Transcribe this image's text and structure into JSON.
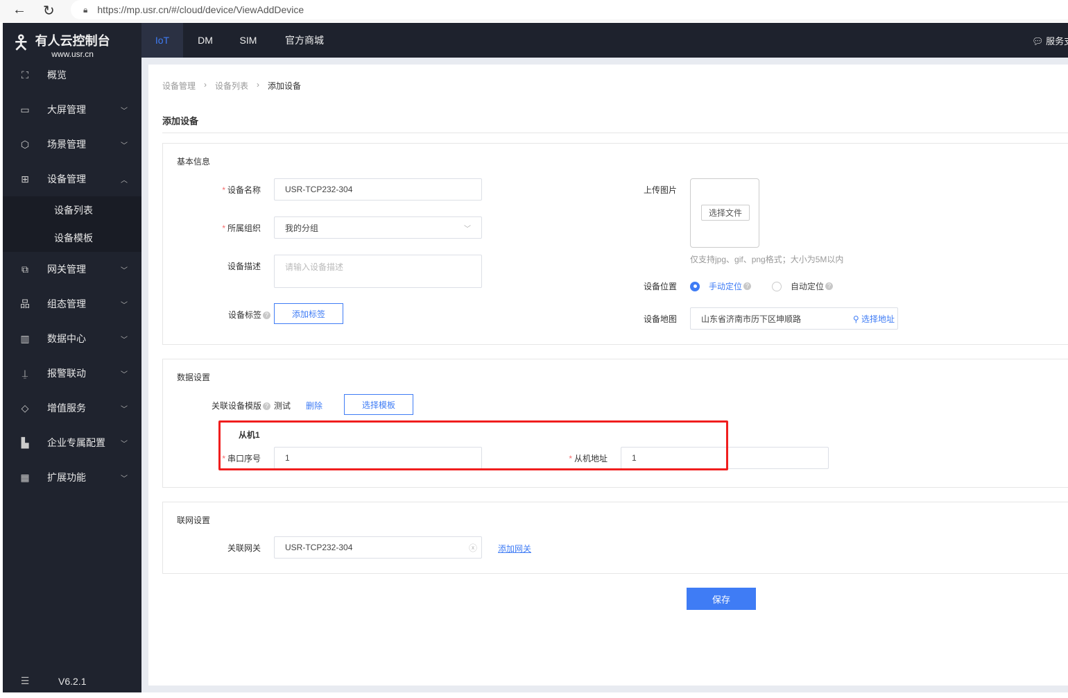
{
  "browser": {
    "url": "https://mp.usr.cn/#/cloud/device/ViewAddDevice"
  },
  "brand": {
    "name": "有人云控制台",
    "site": "www.usr.cn"
  },
  "topnav": {
    "tabs": [
      "IoT",
      "DM",
      "SIM",
      "官方商城"
    ],
    "active": "IoT",
    "service": "服务支持"
  },
  "sidebar": {
    "items": [
      {
        "label": "概览",
        "icon": "scan-icon"
      },
      {
        "label": "大屏管理",
        "icon": "screen-icon"
      },
      {
        "label": "场景管理",
        "icon": "cube-icon"
      },
      {
        "label": "设备管理",
        "icon": "device-grid-icon",
        "expanded": true
      },
      {
        "label": "网关管理",
        "icon": "gateway-icon"
      },
      {
        "label": "组态管理",
        "icon": "topology-icon"
      },
      {
        "label": "数据中心",
        "icon": "bar-chart-icon"
      },
      {
        "label": "报警联动",
        "icon": "alarm-icon"
      },
      {
        "label": "增值服务",
        "icon": "diamond-icon"
      },
      {
        "label": "企业专属配置",
        "icon": "building-icon"
      },
      {
        "label": "扩展功能",
        "icon": "apps-icon"
      }
    ],
    "subitems": [
      "设备列表",
      "设备模板"
    ],
    "version": "V6.2.1"
  },
  "breadcrumb": [
    "设备管理",
    "设备列表",
    "添加设备"
  ],
  "page": {
    "title": "添加设备"
  },
  "basic": {
    "title": "基本信息",
    "name_label": "设备名称",
    "name_value": "USR-TCP232-304",
    "org_label": "所属组织",
    "org_value": "我的分组",
    "desc_label": "设备描述",
    "desc_placeholder": "请输入设备描述",
    "tag_label": "设备标签",
    "tag_button": "添加标签",
    "upload_label": "上传图片",
    "upload_button": "选择文件",
    "upload_hint": "仅支持jpg、gif、png格式；大小为5M以内",
    "location_label": "设备位置",
    "loc_manual": "手动定位",
    "loc_auto": "自动定位",
    "loc_selected": "手动定位",
    "map_label": "设备地图",
    "map_value": "山东省济南市历下区坤顺路",
    "map_button": "选择地址"
  },
  "data_settings": {
    "title": "数据设置",
    "template_label": "关联设备模版",
    "template_value": "测试",
    "delete": "删除",
    "choose_button": "选择模板",
    "slave_title": "从机1",
    "serial_label": "串口序号",
    "serial_value": "1",
    "slave_addr_label": "从机地址",
    "slave_addr_value": "1"
  },
  "network": {
    "title": "联网设置",
    "gateway_label": "关联网关",
    "gateway_value": "USR-TCP232-304",
    "add_gateway": "添加网关"
  },
  "save_button": "保存",
  "colors": {
    "accent": "#3f7cf5",
    "sidebar": "#1f232e",
    "highlight": "#f01e1e"
  }
}
